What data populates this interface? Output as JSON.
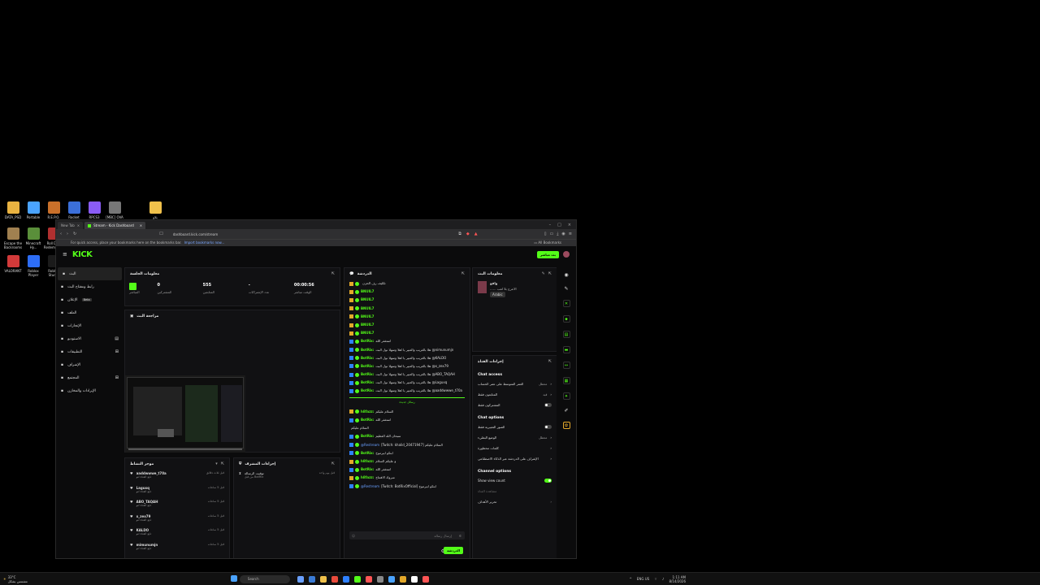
{
  "desktop": {
    "icons_row1": [
      {
        "label": "DATA_PSD",
        "color": "#e9b341"
      },
      {
        "label": "Portable",
        "color": "#4aa3ff"
      },
      {
        "label": "R.E.P.O.",
        "color": "#c9702a"
      },
      {
        "label": "Rocket",
        "color": "#3b6fd9"
      },
      {
        "label": "RPCS3",
        "color": "#8a5cf6"
      },
      {
        "label": "[MBC] OVA",
        "color": "#777"
      },
      {
        "label": "بلاو",
        "color": "#f0c14b"
      }
    ],
    "icons_row2": [
      {
        "label": "Escape the Backrooms",
        "color": "#a08050"
      },
      {
        "label": "Minecraft Hy...",
        "color": "#5a8f3a"
      },
      {
        "label": "Roll Dun Redemption",
        "color": "#b03030"
      }
    ],
    "icons_row3": [
      {
        "label": "VALORANT",
        "color": "#d23a3a"
      },
      {
        "label": "Roblox Player",
        "color": "#2d6df6"
      },
      {
        "label": "Roblox Studio",
        "color": "#1b1b1b"
      }
    ]
  },
  "browser": {
    "tabs": [
      {
        "label": "New Tab"
      },
      {
        "label": "Stream - Kick Dashboard"
      }
    ],
    "url": "dashboard.kick.com/stream",
    "bookmarks_hint": "For quick access, place your bookmarks here on the bookmarks bar.",
    "bookmarks_link": "Import bookmarks now...",
    "all_bookmarks": "All Bookmarks"
  },
  "kick": {
    "logo": "KICK",
    "go_live": "بث مباشر",
    "sidebar": [
      {
        "label": "البث",
        "active": true
      },
      {
        "label": "رابط ومفتاح البث"
      },
      {
        "label": "الإعلان",
        "badge": "Beta"
      },
      {
        "label": "الملف"
      },
      {
        "label": "الإنجازات"
      },
      {
        "label": "الاستوديو",
        "extra": "▤"
      },
      {
        "label": "التطبيقات",
        "extra": "⊞"
      },
      {
        "label": "الإشراف"
      },
      {
        "label": "المجتمع",
        "extra": "⊞"
      },
      {
        "label": "الإيرادات والمخازن"
      }
    ],
    "session": {
      "title": "معلومات الجلسة",
      "stats": [
        {
          "value": "0",
          "label": "المشتركين"
        },
        {
          "value": "555",
          "label": "المتابعين"
        },
        {
          "value": "-",
          "label": "عدد الإشتراكات"
        },
        {
          "value": "00:00:56",
          "label": "الوقت مباشر"
        }
      ],
      "live_label": "المباشر"
    },
    "preview_title": "مراجعة البث",
    "activity": {
      "title": "موجز النشاط",
      "items": [
        {
          "name": "aaddwwwe_t70a",
          "sub": "تابع القناة لتو",
          "time": "قبل ثلاث دقائق"
        },
        {
          "name": "Laguxq",
          "sub": "تابع القناة لتو",
          "time": "قبل 5 ساعات"
        },
        {
          "name": "ABO_TAQAH",
          "sub": "تابع القناة لتو",
          "time": "قبل 5 ساعات"
        },
        {
          "name": "x_zex79",
          "sub": "تابع القناة لتو",
          "time": "قبل 5 ساعات"
        },
        {
          "name": "KALDO",
          "sub": "تابع القناة لتو",
          "time": "قبل 5 ساعات"
        },
        {
          "name": "mimunumjn",
          "sub": "تابع القناة لتو",
          "time": "قبل 5 ساعات"
        }
      ]
    },
    "mod_actions": {
      "title": "إجراءات المشرف",
      "item_title": "توقيت الرسالة",
      "item_sub": "من قبل BotRix",
      "time": "قبل يوم واحد"
    },
    "chat": {
      "title": "الدردشة",
      "messages": [
        {
          "badge": "b1",
          "user": "",
          "text": "تكليف رف الحزن"
        },
        {
          "badge": "b1",
          "user": "BNUIL7",
          "text": ""
        },
        {
          "badge": "b1",
          "user": "BNUIL7",
          "text": ""
        },
        {
          "badge": "b1",
          "user": "BNUIL7",
          "text": ""
        },
        {
          "badge": "b1",
          "user": "BNUIL7",
          "text": ""
        },
        {
          "badge": "b1",
          "user": "BNUIL7",
          "text": ""
        },
        {
          "badge": "b1",
          "user": "BNUIL7",
          "text": ""
        },
        {
          "badge": "b2",
          "user": "BotRix:",
          "text": "استغفر الله"
        },
        {
          "badge": "b2",
          "user": "BotRix:",
          "text": "هلا بالغريب والعبير يا اهلا وسهلا نول البث @nimunumjn"
        },
        {
          "badge": "b2",
          "user": "BotRix:",
          "text": "هلا بالغريب والعبير يا اهلا وسهلا نول البث @KALDO"
        },
        {
          "badge": "b2",
          "user": "BotRix:",
          "text": "هلا بالغريب والعبير يا اهلا وسهلا نول البث @x_zex79"
        },
        {
          "badge": "b2",
          "user": "BotRix:",
          "text": "هلا بالغريب والعبير يا اهلا وسهلا نول البث @ABO_TAQAH"
        },
        {
          "badge": "b2",
          "user": "BotRix:",
          "text": "هلا بالغريب والعبير يا اهلا وسهلا نول البث @Laguxq"
        },
        {
          "badge": "b2",
          "user": "BotRix:",
          "text": "هلا بالغريب والعبير يا اهلا وسهلا نول البث @aaddwwwe_t70a"
        }
      ],
      "divider": "رسائل جديدة",
      "messages2": [
        {
          "badge": "b1",
          "user": "h8fazz:",
          "text": "السلام عليكم"
        },
        {
          "badge": "b2",
          "user": "BotRix:",
          "text": "استغفر الله"
        },
        {
          "badge": "",
          "user": "",
          "text": "السلام عليكم"
        },
        {
          "badge": "b2",
          "user": "BotRix:",
          "text": "سبحان الله العظيم"
        },
        {
          "badge": "b2",
          "user": "@Restream",
          "text": "[Twitch: khalid_20471947] السلام عليكم"
        },
        {
          "badge": "b2",
          "user": "BotRix:",
          "text": "ابتكو ابيرموح"
        },
        {
          "badge": "b1",
          "user": "h8fazz:",
          "text": "و عليكم السلام"
        },
        {
          "badge": "b2",
          "user": "BotRix:",
          "text": "استغفر الله"
        },
        {
          "badge": "b1",
          "user": "h8fazz:",
          "text": "مبروك الافتتاح"
        },
        {
          "badge": "b2",
          "user": "@Restream",
          "text": "[Twitch: BotRixOfficial] ابتكو ابيرموح"
        }
      ],
      "input_placeholder": "إرسال رسالة",
      "send_label": "الدردشة"
    },
    "stream_info": {
      "title": "معلومات البث",
      "stream_title": "...... الاعرج بلا لعب",
      "category": "Arabic",
      "streamer": "واقع"
    },
    "channel_actions": {
      "title": "إجراءات القناة",
      "chat_access": "Chat access",
      "rows_access": [
        {
          "label": "العمر المتوسط على عمر الحساب",
          "value": "معطل"
        },
        {
          "label": "المتابعون فقط",
          "value": "قيد"
        },
        {
          "label": "المشتركون فقط",
          "toggle": false
        }
      ],
      "chat_options": "Chat options",
      "rows_options": [
        {
          "label": "الصور التعبيرية فقط",
          "toggle": false
        },
        {
          "label": "الوضع البطيء",
          "value": "معطل"
        },
        {
          "label": "كلمات محظورة",
          "value": ""
        },
        {
          "label": "الإشراف على الدردشة عبر الذكاء الاصطناعي",
          "value": ""
        }
      ],
      "channel_options": "Channel options",
      "show_view_count": "Show view count",
      "show_view_count_on": true,
      "muted_text": "مشاهدة القناة",
      "goals": "تحرير الأهداف"
    }
  },
  "taskbar": {
    "weather": "33°C",
    "weather_sub": "مشمس بشكل",
    "search": "Search",
    "lang": "ENG US",
    "time": "1:11 AM",
    "date": "8/14/2026"
  }
}
